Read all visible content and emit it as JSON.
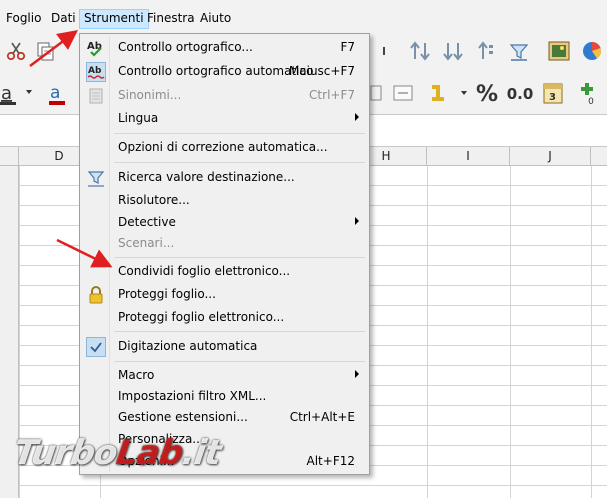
{
  "menubar": {
    "items": [
      "Foglio",
      "Dati",
      "Strumenti",
      "Finestra",
      "Aiuto"
    ],
    "active": "Strumenti"
  },
  "toolbar": {
    "sort_icons": [
      "sort-ascending-icon",
      "sort-descending-icon",
      "sort-icon",
      "autofilter-icon"
    ],
    "percent_label": "%",
    "decimal_label": "0.0",
    "number_format_small": "0"
  },
  "grid": {
    "columns_left": [
      "D"
    ],
    "columns_right": [
      "H",
      "I",
      "J"
    ]
  },
  "menu": {
    "items": [
      {
        "label": "Controllo ortografico...",
        "shortcut": "F7",
        "icon": "spellcheck-icon",
        "disabled": false
      },
      {
        "label": "Controllo ortografico automatico",
        "shortcut": "Maiusc+F7",
        "icon": "autospellcheck-icon",
        "disabled": false
      },
      {
        "label": "Sinonimi...",
        "shortcut": "Ctrl+F7",
        "icon": "thesaurus-icon",
        "disabled": true
      },
      {
        "label": "Lingua",
        "shortcut": "",
        "submenu": true,
        "disabled": false
      },
      {
        "label": "Opzioni di correzione automatica...",
        "shortcut": "",
        "disabled": false
      },
      {
        "label": "Ricerca valore destinazione...",
        "shortcut": "",
        "icon": "goal-seek-icon",
        "disabled": false
      },
      {
        "label": "Risolutore...",
        "shortcut": "",
        "disabled": false
      },
      {
        "label": "Detective",
        "shortcut": "",
        "submenu": true,
        "disabled": false
      },
      {
        "label": "Scenari...",
        "shortcut": "",
        "disabled": true
      },
      {
        "label": "Condividi foglio elettronico...",
        "shortcut": "",
        "disabled": false
      },
      {
        "label": "Proteggi foglio...",
        "shortcut": "",
        "icon": "lock-icon",
        "disabled": false
      },
      {
        "label": "Proteggi foglio elettronico...",
        "shortcut": "",
        "disabled": false
      },
      {
        "label": "Digitazione automatica",
        "shortcut": "",
        "icon": "checkmark-icon",
        "disabled": false
      },
      {
        "label": "Macro",
        "shortcut": "",
        "submenu": true,
        "disabled": false
      },
      {
        "label": "Impostazioni filtro XML...",
        "shortcut": "",
        "disabled": false
      },
      {
        "label": "Gestione estensioni...",
        "shortcut": "Ctrl+Alt+E",
        "disabled": false
      },
      {
        "label": "Personalizza...",
        "shortcut": "",
        "disabled": false
      },
      {
        "label": "Opzioni...",
        "shortcut": "Alt+F12",
        "disabled": false
      }
    ]
  },
  "watermark": {
    "part1": "Turbo",
    "part2": "Lab",
    "part3": ".it"
  },
  "colors": {
    "accent_active_menu": "#cde8ff",
    "annotation_arrow": "#e02020",
    "check_highlight": "#99ccf0"
  }
}
